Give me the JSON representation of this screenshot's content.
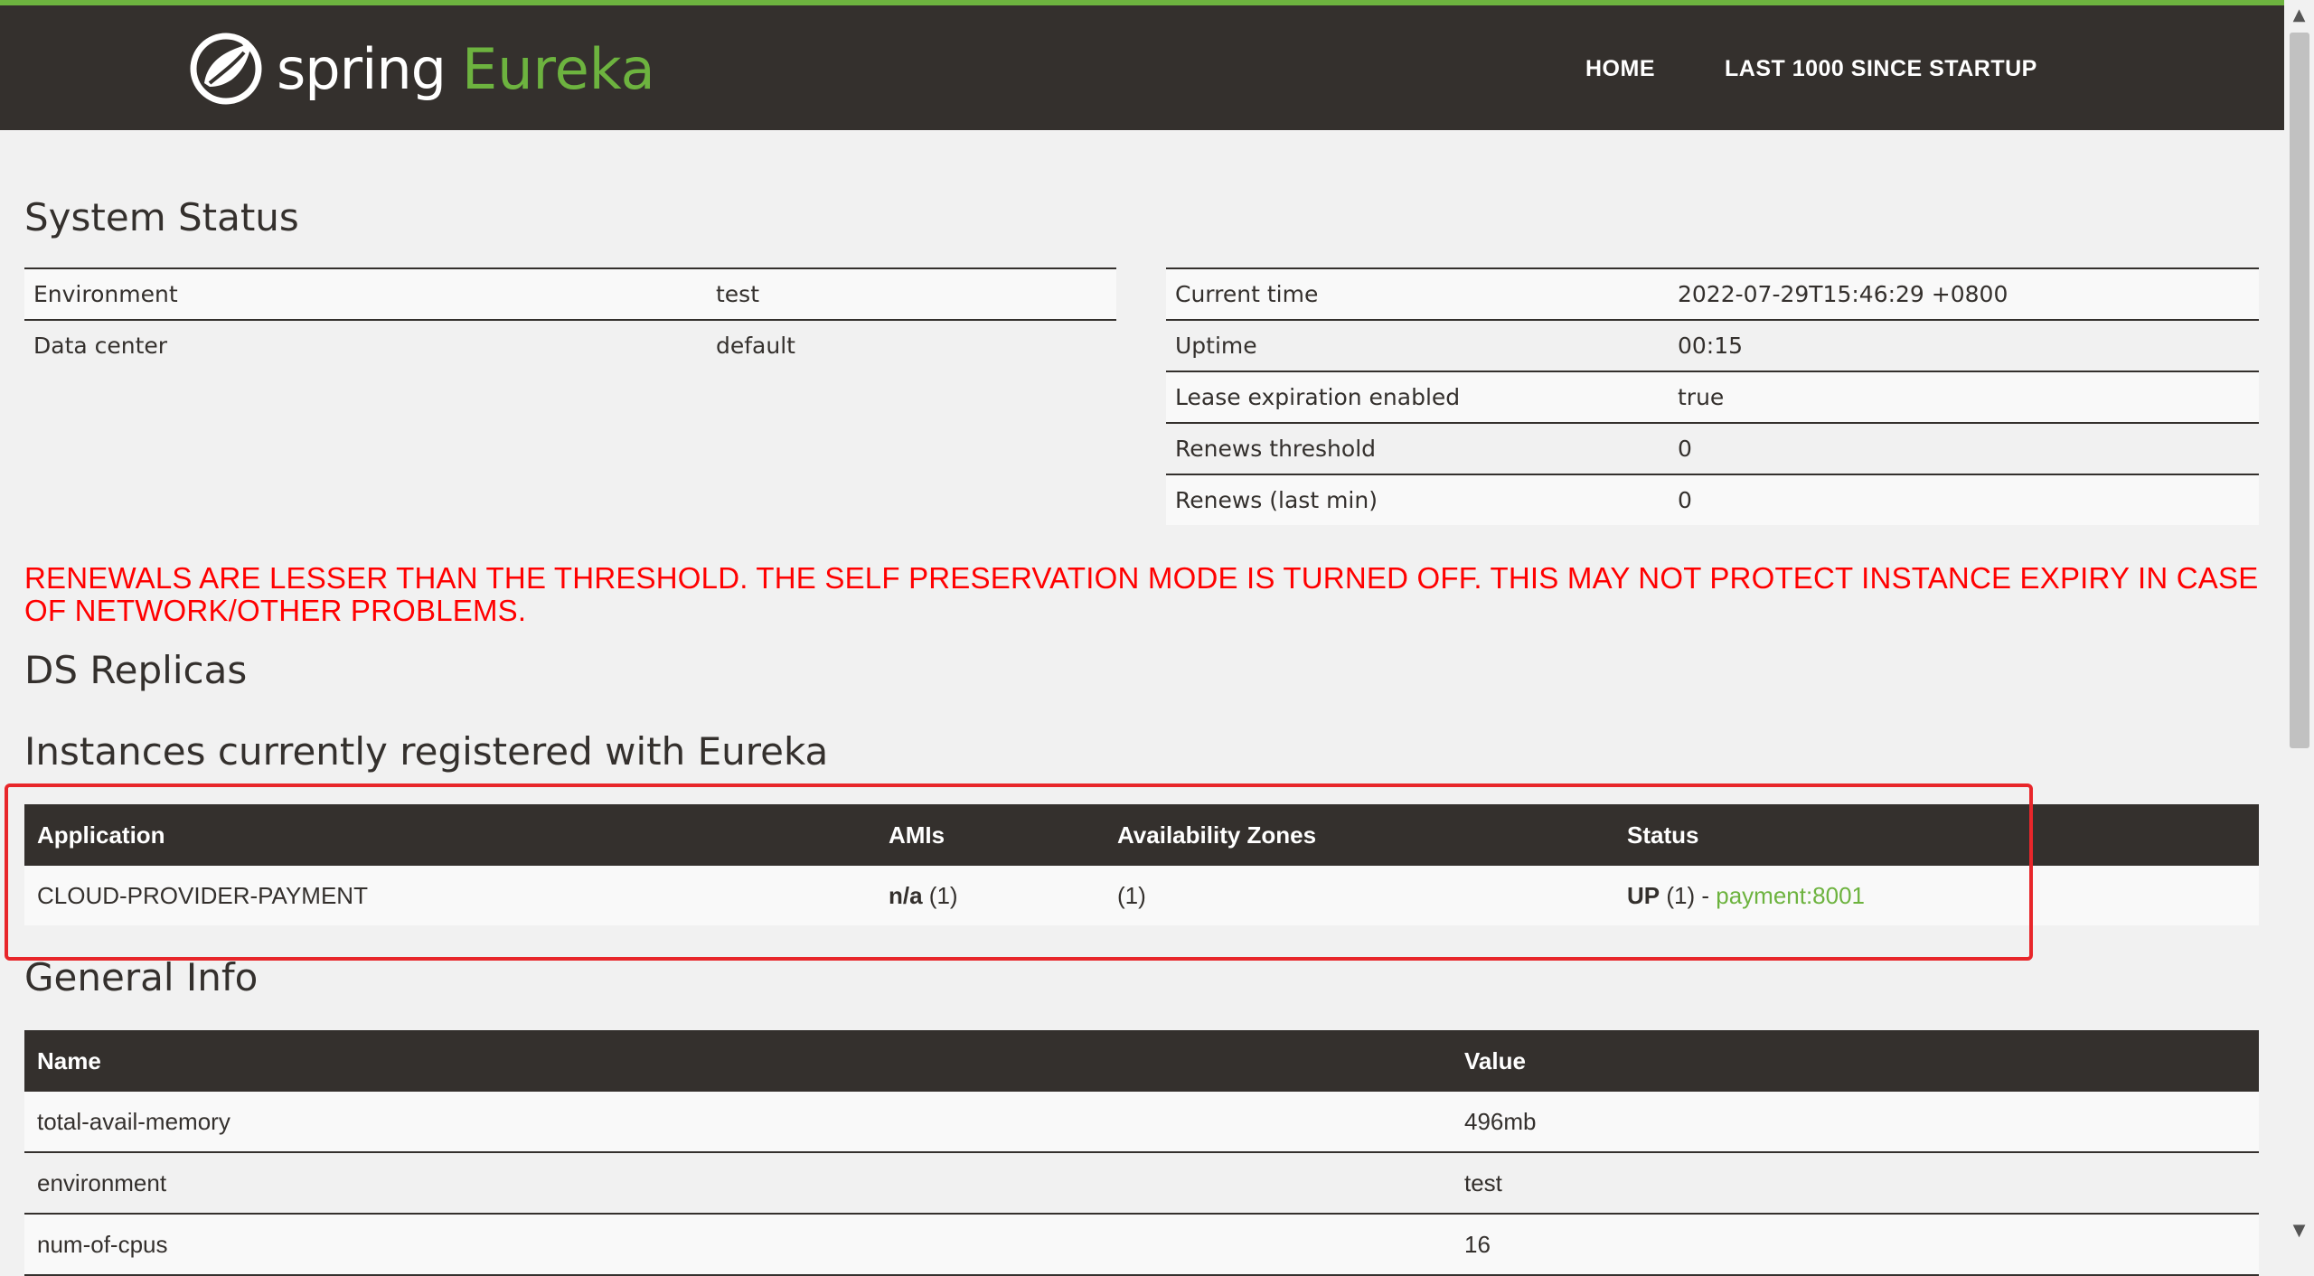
{
  "brand": {
    "spring": "spring",
    "eureka": "Eureka"
  },
  "nav": {
    "home": "HOME",
    "last1000": "LAST 1000 SINCE STARTUP"
  },
  "system_status": {
    "title": "System Status",
    "left": [
      {
        "label": "Environment",
        "value": "test"
      },
      {
        "label": "Data center",
        "value": "default"
      }
    ],
    "right": [
      {
        "label": "Current time",
        "value": "2022-07-29T15:46:29 +0800"
      },
      {
        "label": "Uptime",
        "value": "00:15"
      },
      {
        "label": "Lease expiration enabled",
        "value": "true"
      },
      {
        "label": "Renews threshold",
        "value": "0"
      },
      {
        "label": "Renews (last min)",
        "value": "0"
      }
    ]
  },
  "warning": "RENEWALS ARE LESSER THAN THE THRESHOLD. THE SELF PRESERVATION MODE IS TURNED OFF. THIS MAY NOT PROTECT INSTANCE EXPIRY IN CASE OF NETWORK/OTHER PROBLEMS.",
  "ds_replicas": {
    "title": "DS Replicas"
  },
  "instances": {
    "title": "Instances currently registered with Eureka",
    "headers": {
      "application": "Application",
      "amis": "AMIs",
      "zones": "Availability Zones",
      "status": "Status"
    },
    "rows": [
      {
        "application": "CLOUD-PROVIDER-PAYMENT",
        "amis_bold": "n/a",
        "amis_count": " (1)",
        "zones": "(1)",
        "status_bold": "UP",
        "status_count": " (1) - ",
        "instance_link": "payment:8001"
      }
    ]
  },
  "general_info": {
    "title": "General Info",
    "headers": {
      "name": "Name",
      "value": "Value"
    },
    "rows": [
      {
        "name": "total-avail-memory",
        "value": "496mb"
      },
      {
        "name": "environment",
        "value": "test"
      },
      {
        "name": "num-of-cpus",
        "value": "16"
      }
    ]
  },
  "colors": {
    "brand_green": "#6db33f",
    "header_dark": "#34302d",
    "warning_red": "#ff0000",
    "highlight_red": "#e8262a"
  }
}
